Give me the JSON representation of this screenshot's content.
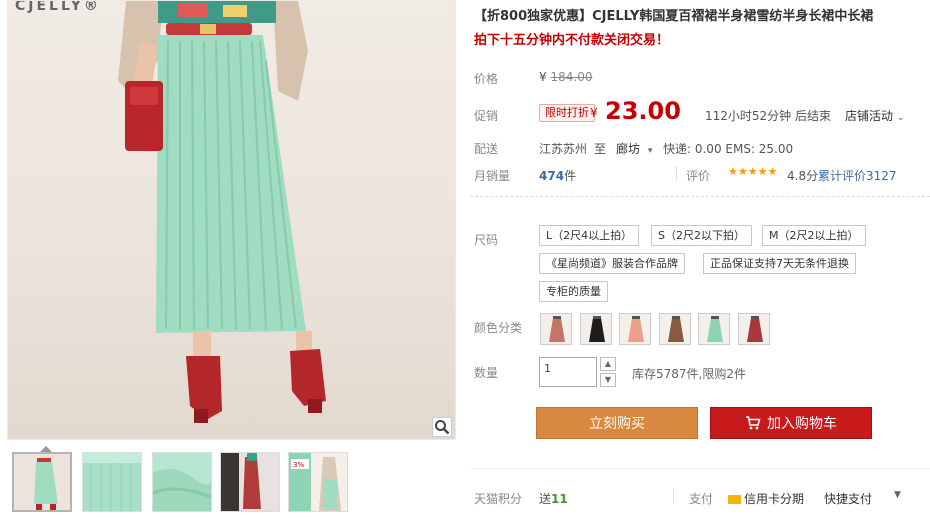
{
  "gallery": {
    "brand_logo": "CJELLY®",
    "zoom_icon": "magnifier-icon",
    "thumbnail_count": 5
  },
  "product": {
    "title": "【折800独家优惠】CJELLY韩国夏百褶裙半身裙雪纺半身长裙中长裙",
    "subtitle": "拍下十五分钟内不付款关闭交易！"
  },
  "price": {
    "label": "价格",
    "currency": "¥",
    "original": "184.00"
  },
  "promo": {
    "label": "促销",
    "tag": "限时打折",
    "currency": "¥",
    "price": "23.00",
    "countdown": "112小时52分钟 后结束",
    "store_activity": "店铺活动",
    "chevron": "⌄"
  },
  "delivery": {
    "label": "配送",
    "from": "江苏苏州",
    "to_word": "至",
    "destination": "廊坊",
    "fees": "快递: 0.00 EMS: 25.00"
  },
  "sales": {
    "label": "月销量",
    "count": "474",
    "unit": "件",
    "rating_label": "评价",
    "stars": "★★★★★",
    "score": "4.8分",
    "reviews": "累计评价3127"
  },
  "size": {
    "label": "尺码",
    "options": [
      "L（2尺4以上拍）",
      "S（2尺2以下拍）",
      "M（2尺2以上拍）",
      "《星尚频道》服装合作品牌",
      "正品保证支持7天无条件退换",
      "专柜的质量"
    ]
  },
  "color": {
    "label": "颜色分类",
    "swatches": [
      "#c57563",
      "#1f1c1b",
      "#e8a08a",
      "#8a5a43",
      "#8fd3b5",
      "#a8393b"
    ]
  },
  "quantity": {
    "label": "数量",
    "value": "1",
    "up": "▲",
    "down": "▼",
    "stock": "库存5787件,限购2件"
  },
  "actions": {
    "buy_now": "立刻购买",
    "add_to_cart": "加入购物车"
  },
  "footer": {
    "points_label": "天猫积分",
    "points_prefix": "送",
    "points_value": "11",
    "pay_label": "支付",
    "credit_card": "信用卡分期",
    "quick_pay": "快捷支付",
    "dropdown": "▼"
  },
  "colors": {
    "price_red": "#c40000",
    "buy_orange": "#d9883f",
    "cart_red": "#c8191b",
    "star_gold": "#ff9a00",
    "link_blue": "#3c6b9f",
    "points_green": "#3a9d23"
  }
}
